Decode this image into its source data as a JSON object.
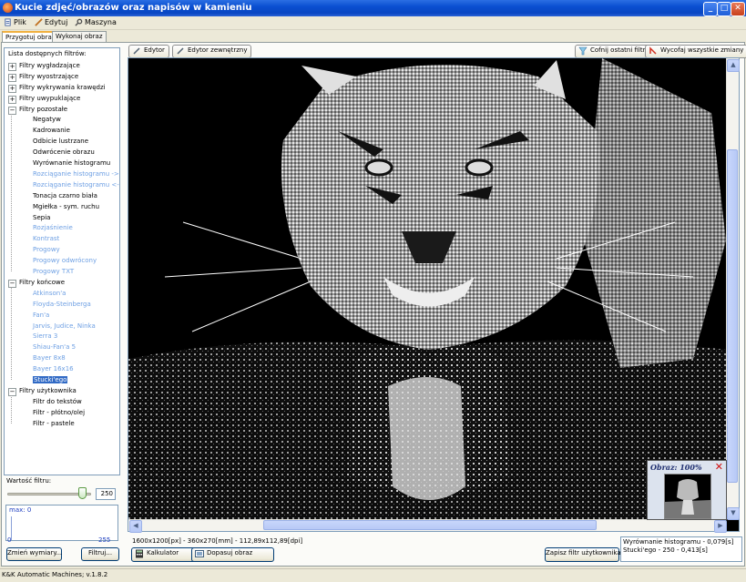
{
  "window": {
    "title": "Kucie zdjęć/obrazów oraz napisów w kamieniu"
  },
  "menu": [
    "Plik",
    "Edytuj",
    "Maszyna"
  ],
  "tabs": [
    "Przygotuj obraz",
    "Wykonaj obraz"
  ],
  "filters": {
    "header": "Lista dostępnych filtrów:",
    "groups": [
      {
        "label": "Filtry wygładzające",
        "expanded": false
      },
      {
        "label": "Filtry wyostrzające",
        "expanded": false
      },
      {
        "label": "Filtry wykrywania krawędzi",
        "expanded": false
      },
      {
        "label": "Filtry uwypuklające",
        "expanded": false
      },
      {
        "label": "Filtry pozostałe",
        "expanded": true,
        "items": [
          {
            "label": "Negatyw",
            "enabled": true
          },
          {
            "label": "Kadrowanie",
            "enabled": true
          },
          {
            "label": "Odbicie lustrzane",
            "enabled": true
          },
          {
            "label": "Odwrócenie obrazu",
            "enabled": true
          },
          {
            "label": "Wyrównanie histogramu",
            "enabled": true
          },
          {
            "label": "Rozciąganie histogramu ->",
            "enabled": false
          },
          {
            "label": "Rozciąganie histogramu <-",
            "enabled": false
          },
          {
            "label": "Tonacja czarno biała",
            "enabled": true
          },
          {
            "label": "Mgiełka - sym. ruchu",
            "enabled": true
          },
          {
            "label": "Sepia",
            "enabled": true
          },
          {
            "label": "Rozjaśnienie",
            "enabled": false
          },
          {
            "label": "Kontrast",
            "enabled": false
          },
          {
            "label": "Progowy",
            "enabled": false
          },
          {
            "label": "Progowy odwrócony",
            "enabled": false
          },
          {
            "label": "Progowy TXT",
            "enabled": false
          }
        ]
      },
      {
        "label": "Filtry końcowe",
        "expanded": true,
        "items": [
          {
            "label": "Atkinson'a",
            "enabled": false
          },
          {
            "label": "Floyda-Steinberga",
            "enabled": false
          },
          {
            "label": "Fan'a",
            "enabled": false
          },
          {
            "label": "Jarvis, Judice, Ninka",
            "enabled": false
          },
          {
            "label": "Sierra 3",
            "enabled": false
          },
          {
            "label": "Shiau-Fan'a 5",
            "enabled": false
          },
          {
            "label": "Bayer 8x8",
            "enabled": false
          },
          {
            "label": "Bayer 16x16",
            "enabled": false
          },
          {
            "label": "Stucki'ego",
            "enabled": true,
            "selected": true
          }
        ]
      },
      {
        "label": "Filtry użytkownika",
        "expanded": true,
        "items": [
          {
            "label": "Filtr do tekstów",
            "enabled": true
          },
          {
            "label": "Filtr - płótno/olej",
            "enabled": true
          },
          {
            "label": "Filtr - pastele",
            "enabled": true
          }
        ]
      }
    ]
  },
  "filter_value": {
    "label": "Wartość filtru:",
    "value": "250",
    "level": 250,
    "max_level": 255
  },
  "histogram": {
    "max_label": "max: 0",
    "min_tick": "0",
    "max_tick": "255"
  },
  "left_buttons": {
    "resize": "Zmień wymiary...",
    "filter": "Filtruj..."
  },
  "toolbar": {
    "editor": "Edytor",
    "external_editor": "Edytor zewnętrzny",
    "undo_last": "Cofnij ostatni filtr",
    "undo_all": "Wycofaj wszystkie zmiany"
  },
  "preview": {
    "title": "Obraz: 100%",
    "close": "✕"
  },
  "info": {
    "dimensions": "1600x1200[px] - 360x270[mm] - 112,89x112,89[dpi]",
    "calculator": "Kalkulator",
    "fit_image": "Dopasuj obraz",
    "save_filter": "Zapisz filtr użytkownika"
  },
  "log": [
    "Wyrównanie histogramu - 0,079[s]",
    "Stucki'ego - 250 - 0,413[s]"
  ],
  "status": "K&K Automatic Machines; v.1.8.2",
  "colors": {
    "titlebar": "#0a4fd1",
    "selection": "#316ac5",
    "disabled_text": "#6d9fe3"
  }
}
